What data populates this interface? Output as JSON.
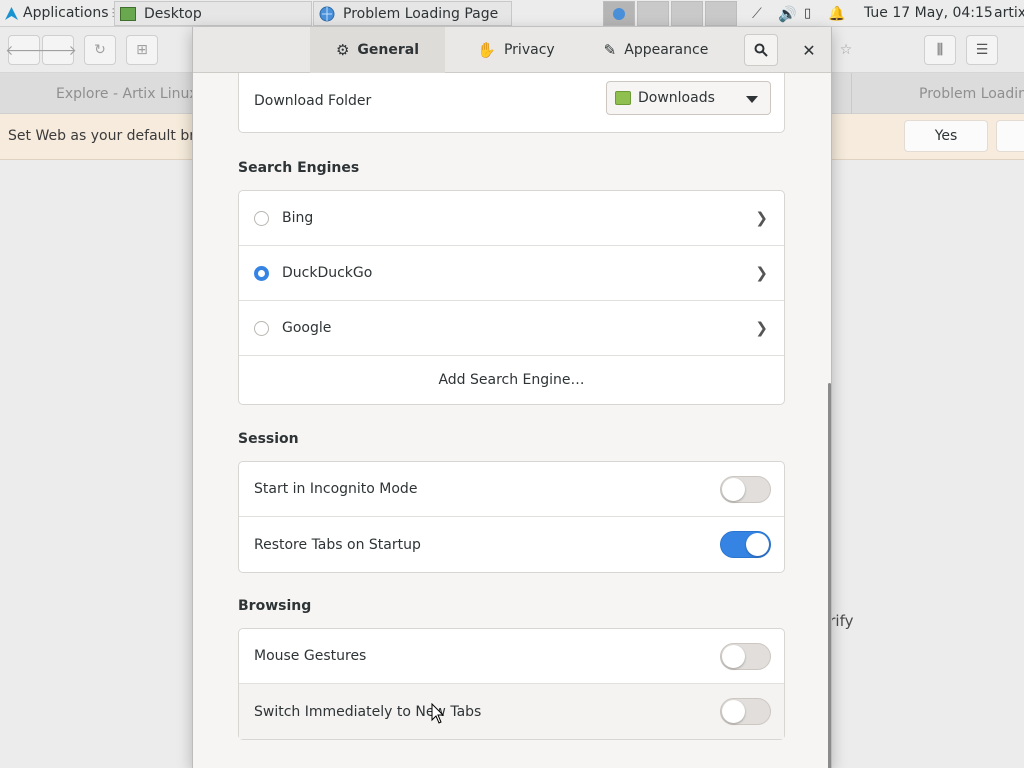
{
  "panel": {
    "apps_label": "Applications",
    "tasks": [
      {
        "label": "Desktop"
      },
      {
        "label": "Problem Loading Page"
      }
    ],
    "clock": "Tue 17 May, 04:15",
    "user": "artix"
  },
  "browser": {
    "tabs": [
      {
        "label": "Explore - Artix Linux"
      },
      {
        "label": "Problem Loading"
      }
    ],
    "infobar": {
      "message": "Set Web as your default bro",
      "yes_label": "Yes"
    },
    "content_fragment": "erify"
  },
  "dialog": {
    "tabs": [
      {
        "label": "General",
        "icon": "gear-icon",
        "active": true
      },
      {
        "label": "Privacy",
        "icon": "hand-icon",
        "active": false
      },
      {
        "label": "Appearance",
        "icon": "pencil-icon",
        "active": false
      }
    ],
    "download": {
      "label": "Download Folder",
      "value": "Downloads"
    },
    "search_engines": {
      "title": "Search Engines",
      "items": [
        {
          "label": "Bing",
          "selected": false
        },
        {
          "label": "DuckDuckGo",
          "selected": true
        },
        {
          "label": "Google",
          "selected": false
        }
      ],
      "add_label": "Add Search Engine…"
    },
    "session": {
      "title": "Session",
      "items": [
        {
          "label": "Start in Incognito Mode",
          "on": false
        },
        {
          "label": "Restore Tabs on Startup",
          "on": true
        }
      ]
    },
    "browsing": {
      "title": "Browsing",
      "items": [
        {
          "label": "Mouse Gestures",
          "on": false
        },
        {
          "label": "Switch Immediately to New Tabs",
          "on": false
        }
      ]
    }
  },
  "colors": {
    "accent": "#3584e4",
    "infobar": "#f6ebdc"
  }
}
